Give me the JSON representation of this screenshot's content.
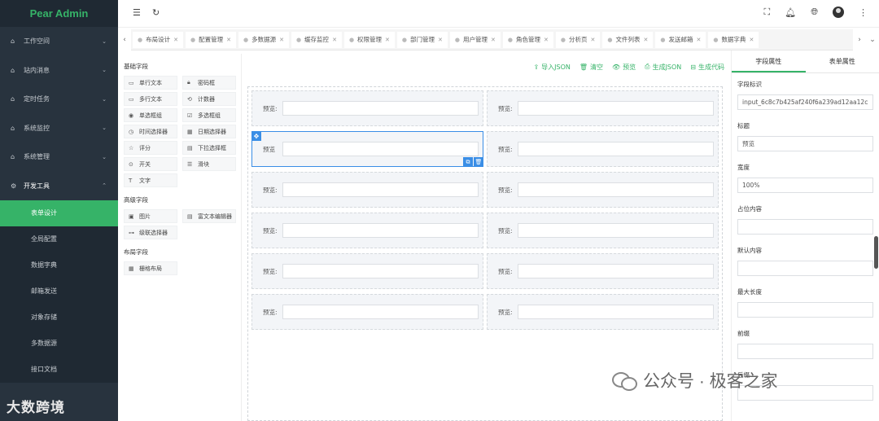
{
  "app": {
    "title": "Pear Admin"
  },
  "sidebar": {
    "items": [
      {
        "label": "工作空间",
        "icon": "home-icon",
        "open": false
      },
      {
        "label": "站内消息",
        "icon": "home-icon",
        "open": false
      },
      {
        "label": "定时任务",
        "icon": "home-icon",
        "open": false
      },
      {
        "label": "系统监控",
        "icon": "home-icon",
        "open": false
      },
      {
        "label": "系统管理",
        "icon": "home-icon",
        "open": false
      },
      {
        "label": "开发工具",
        "icon": "gear-icon",
        "open": true
      }
    ],
    "sub_items": [
      {
        "label": "表单设计",
        "active": true
      },
      {
        "label": "全局配置",
        "active": false
      },
      {
        "label": "数据字典",
        "active": false
      },
      {
        "label": "邮箱发送",
        "active": false
      },
      {
        "label": "对象存储",
        "active": false
      },
      {
        "label": "多数据源",
        "active": false
      },
      {
        "label": "接口文档",
        "active": false
      }
    ],
    "brand": "大数跨境"
  },
  "tabs": [
    "布局设计",
    "配置管理",
    "多数据源",
    "缓存监控",
    "权限管理",
    "部门管理",
    "用户管理",
    "角色管理",
    "分析页",
    "文件列表",
    "发送邮箱",
    "数据字典"
  ],
  "palette": {
    "basic_title": "基础字段",
    "basic": [
      {
        "label": "单行文本",
        "icon": "input-icon"
      },
      {
        "label": "密码框",
        "icon": "lock-icon"
      },
      {
        "label": "多行文本",
        "icon": "textarea-icon"
      },
      {
        "label": "计数器",
        "icon": "counter-icon"
      },
      {
        "label": "单选框组",
        "icon": "radio-icon"
      },
      {
        "label": "多选框组",
        "icon": "checkbox-icon"
      },
      {
        "label": "时间选择器",
        "icon": "clock-icon"
      },
      {
        "label": "日期选择器",
        "icon": "calendar-icon"
      },
      {
        "label": "评分",
        "icon": "star-icon"
      },
      {
        "label": "下拉选择框",
        "icon": "select-icon"
      },
      {
        "label": "开关",
        "icon": "switch-icon"
      },
      {
        "label": "滑块",
        "icon": "slider-icon"
      },
      {
        "label": "文字",
        "icon": "text-icon"
      }
    ],
    "advanced_title": "高级字段",
    "advanced": [
      {
        "label": "图片",
        "icon": "image-icon"
      },
      {
        "label": "富文本编辑器",
        "icon": "editor-icon"
      },
      {
        "label": "级联选择器",
        "icon": "cascader-icon"
      }
    ],
    "layout_title": "布局字段",
    "layout": [
      {
        "label": "栅格布局",
        "icon": "grid-icon"
      }
    ]
  },
  "toolbar": {
    "import_json": "导入JSON",
    "clear": "清空",
    "preview": "预览",
    "gen_json": "生成JSON",
    "gen_code": "生成代码"
  },
  "form_field_label": "预览:",
  "form_field_label_selected": "预览",
  "properties": {
    "tabs": [
      "字段属性",
      "表单属性"
    ],
    "fields": [
      {
        "label": "字段标识",
        "value": "input_6c8c7b425af240f6a239ad12aa12c"
      },
      {
        "label": "标题",
        "value": "预览"
      },
      {
        "label": "宽度",
        "value": "100%"
      },
      {
        "label": "占位内容",
        "value": ""
      },
      {
        "label": "默认内容",
        "value": ""
      },
      {
        "label": "最大长度",
        "value": ""
      },
      {
        "label": "前缀",
        "value": ""
      },
      {
        "label": "后缀",
        "value": ""
      }
    ]
  },
  "watermark": {
    "text": "公众号 · 极客之家"
  }
}
